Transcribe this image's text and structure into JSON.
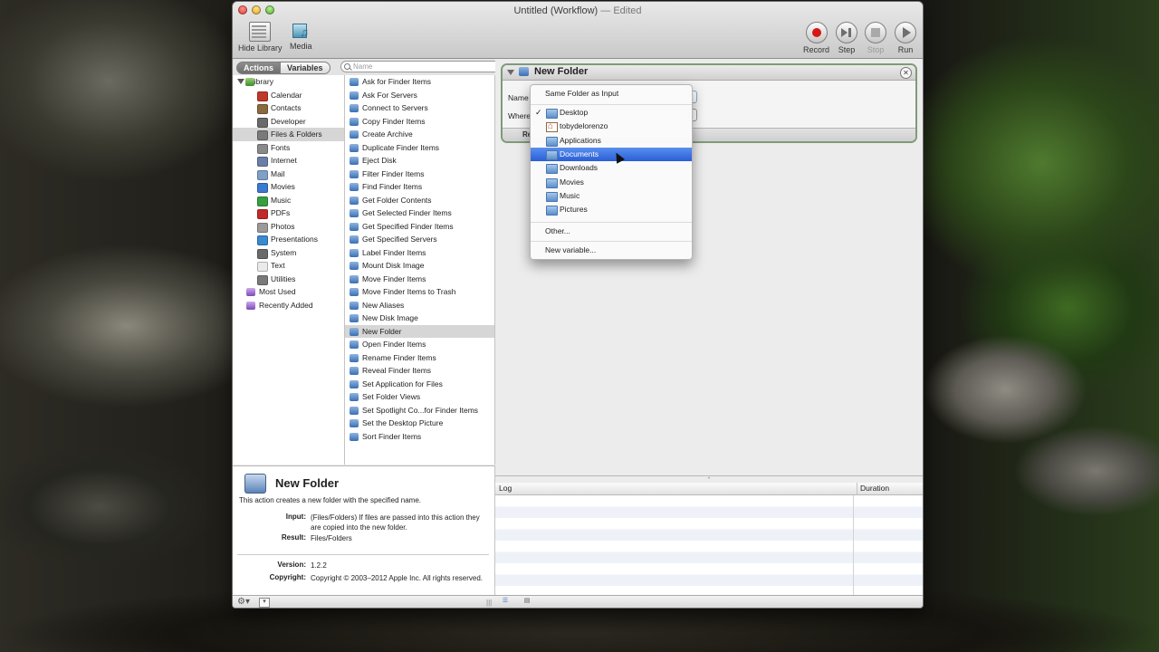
{
  "window": {
    "title": "Untitled (Workflow)",
    "edited": "— Edited"
  },
  "toolbar": {
    "hide_library": "Hide Library",
    "media": "Media",
    "record": "Record",
    "step": "Step",
    "stop": "Stop",
    "run": "Run"
  },
  "library_header": {
    "actions_tab": "Actions",
    "variables_tab": "Variables",
    "search_placeholder": "Name"
  },
  "library": {
    "root": "Library",
    "items": [
      "Calendar",
      "Contacts",
      "Developer",
      "Files & Folders",
      "Fonts",
      "Internet",
      "Mail",
      "Movies",
      "Music",
      "PDFs",
      "Photos",
      "Presentations",
      "System",
      "Text",
      "Utilities"
    ],
    "item_colors": [
      "#c0392b",
      "#8b6a3e",
      "#6a6a6a",
      "#7a7a7a",
      "#8a8a8a",
      "#6a7fa8",
      "#7fa0c8",
      "#3a7ad0",
      "#36a040",
      "#c02a2a",
      "#9a9a9a",
      "#3a8ad0",
      "#6a6a6a",
      "#eaeaea",
      "#7a7a7a"
    ],
    "collections": [
      "Most Used",
      "Recently Added"
    ],
    "selected": "Files & Folders"
  },
  "actions": {
    "items": [
      "Ask for Finder Items",
      "Ask For Servers",
      "Connect to Servers",
      "Copy Finder Items",
      "Create Archive",
      "Duplicate Finder Items",
      "Eject Disk",
      "Filter Finder Items",
      "Find Finder Items",
      "Get Folder Contents",
      "Get Selected Finder Items",
      "Get Specified Finder Items",
      "Get Specified Servers",
      "Label Finder Items",
      "Mount Disk Image",
      "Move Finder Items",
      "Move Finder Items to Trash",
      "New Aliases",
      "New Disk Image",
      "New Folder",
      "Open Finder Items",
      "Rename Finder Items",
      "Reveal Finder Items",
      "Set Application for Files",
      "Set Folder Views",
      "Set Spotlight Co...for Finder Items",
      "Set the Desktop Picture",
      "Sort Finder Items"
    ],
    "selected": "New Folder"
  },
  "description": {
    "title": "New Folder",
    "summary": "This action creates a new folder with the specified name.",
    "input_label": "Input:",
    "input_value": "(Files/Folders) If files are passed into this action they are copied into the new folder.",
    "result_label": "Result:",
    "result_value": "Files/Folders",
    "version_label": "Version:",
    "version_value": "1.2.2",
    "copyright_label": "Copyright:",
    "copyright_value": "Copyright © 2003–2012 Apple Inc.  All rights reserved."
  },
  "action_card": {
    "title": "New Folder",
    "name_label": "Name",
    "where_label": "Where",
    "footer_label": "Re"
  },
  "popup": {
    "first": "Same Folder as Input",
    "checked": "Desktop",
    "folders": [
      "Desktop",
      "tobydelorenzo",
      "Applications",
      "Documents",
      "Downloads",
      "Movies",
      "Music",
      "Pictures"
    ],
    "highlighted": "Documents",
    "other": "Other...",
    "new_variable": "New variable..."
  },
  "log": {
    "col_log": "Log",
    "col_duration": "Duration"
  }
}
